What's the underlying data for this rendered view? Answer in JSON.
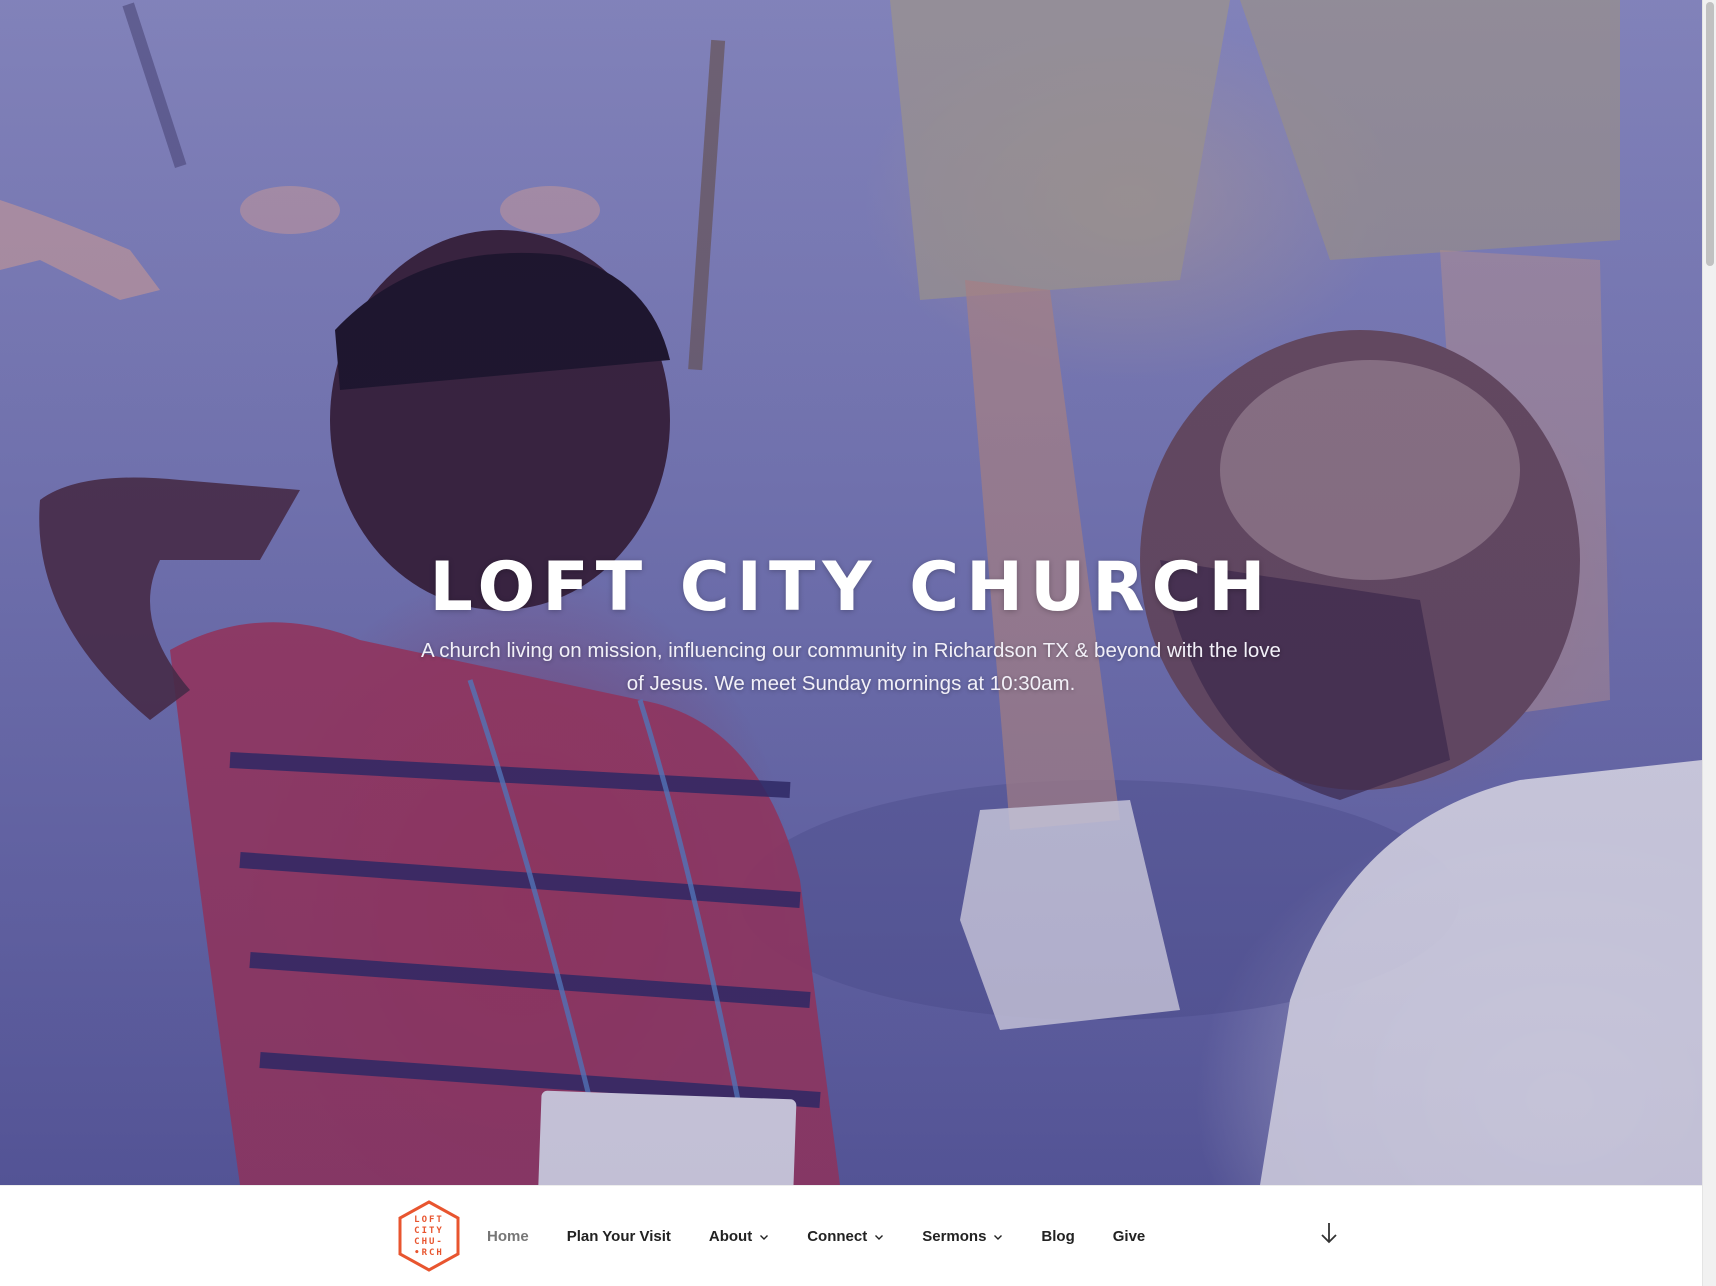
{
  "site": {
    "title": "LOFT CITY CHURCH",
    "tagline": "A church living on mission, influencing our community in Richardson TX & beyond with the love of Jesus. We meet Sunday mornings at 10:30am."
  },
  "logo": {
    "lines": [
      "LOFT",
      "CITY",
      "CHU-",
      "•RCH"
    ],
    "color": "#e8552f"
  },
  "nav": {
    "items": [
      {
        "label": "Home",
        "current": true,
        "has_submenu": false
      },
      {
        "label": "Plan Your Visit",
        "current": false,
        "has_submenu": false
      },
      {
        "label": "About",
        "current": false,
        "has_submenu": true
      },
      {
        "label": "Connect",
        "current": false,
        "has_submenu": true
      },
      {
        "label": "Sermons",
        "current": false,
        "has_submenu": true
      },
      {
        "label": "Blog",
        "current": false,
        "has_submenu": false
      },
      {
        "label": "Give",
        "current": false,
        "has_submenu": false
      }
    ],
    "scroll_icon": "arrow-down-icon"
  },
  "colors": {
    "accent": "#e8552f",
    "nav_text": "#222222",
    "nav_current": "#767676",
    "hero_tint": "#7d80b9"
  }
}
